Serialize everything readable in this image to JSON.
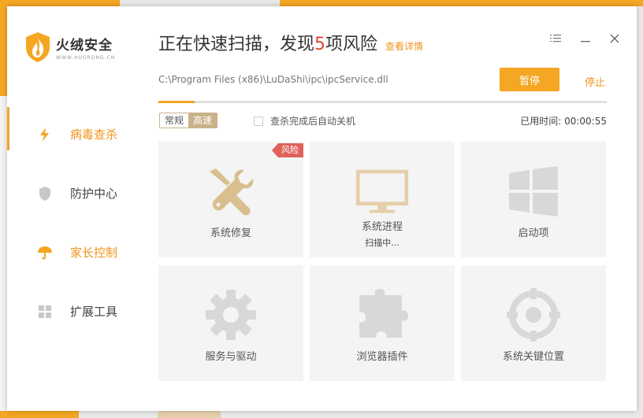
{
  "app": {
    "logo_title": "火绒安全",
    "logo_sub": "WWW.HUORONG.CN"
  },
  "sidebar": {
    "items": [
      {
        "label": "病毒查杀",
        "icon": "lightning-icon",
        "active": true
      },
      {
        "label": "防护中心",
        "icon": "shield-icon",
        "active": false
      },
      {
        "label": "家长控制",
        "icon": "umbrella-icon",
        "active": false
      },
      {
        "label": "扩展工具",
        "icon": "grid-icon",
        "active": false
      }
    ]
  },
  "scan": {
    "title_prefix": "正在快速扫描，发现",
    "risk_count": "5",
    "title_suffix": "项风险",
    "details_link": "查看详情",
    "current_path": "C:\\Program Files (x86)\\LuDaShi\\ipc\\ipcService.dll",
    "pause_label": "暂停",
    "stop_label": "停止",
    "progress": 0.08,
    "modes": [
      "常规",
      "高速"
    ],
    "selected_mode": "高速",
    "auto_shutdown_label": "查杀完成后自动关机",
    "elapsed_label": "已用时间:",
    "elapsed_value": "00:00:55"
  },
  "tiles": [
    {
      "label": "系统修复",
      "icon": "tools-icon",
      "badge": "风险",
      "status": ""
    },
    {
      "label": "系统进程",
      "icon": "monitor-icon",
      "badge": "",
      "status": "扫描中..."
    },
    {
      "label": "启动项",
      "icon": "windows-icon",
      "badge": "",
      "status": ""
    },
    {
      "label": "服务与驱动",
      "icon": "gear-icon",
      "badge": "",
      "status": ""
    },
    {
      "label": "浏览器插件",
      "icon": "puzzle-icon",
      "badge": "",
      "status": ""
    },
    {
      "label": "系统关键位置",
      "icon": "target-icon",
      "badge": "",
      "status": ""
    }
  ],
  "colors": {
    "accent": "#f5a623",
    "accent_text": "#f0941b",
    "risk": "#e0625a",
    "mode_selected": "#c9b189",
    "tile_bg": "#f4f4f4",
    "icon_active": "#d9bf8f",
    "icon_idle": "#d8d8d8"
  }
}
